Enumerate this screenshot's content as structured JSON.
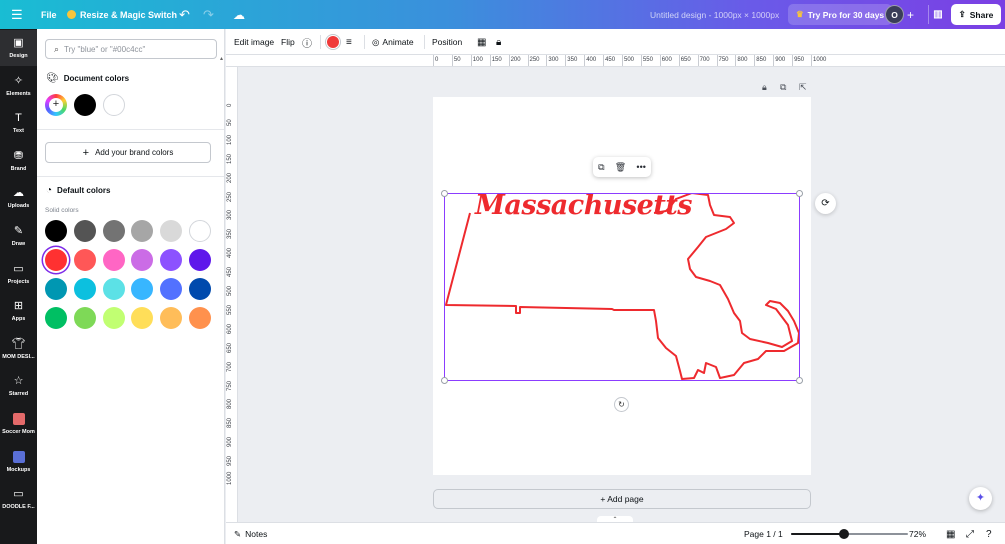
{
  "topbar": {
    "menu_icon": "hamburger-icon",
    "file_label": "File",
    "resize_label": "Resize & Magic Switch",
    "undo_icon": "undo-icon",
    "redo_icon": "redo-icon",
    "cloud_icon": "cloud-icon",
    "design_title": "Untitled design - 1000px × 1000px",
    "pro_label": "Try Pro for 30 days",
    "avatar_initial": "O",
    "share_label": "Share"
  },
  "rail": {
    "items": [
      {
        "label": "Design",
        "icon": "design-icon"
      },
      {
        "label": "Elements",
        "icon": "elements-icon"
      },
      {
        "label": "Text",
        "icon": "text-icon"
      },
      {
        "label": "Brand",
        "icon": "brand-icon"
      },
      {
        "label": "Uploads",
        "icon": "uploads-icon"
      },
      {
        "label": "Draw",
        "icon": "draw-icon"
      },
      {
        "label": "Projects",
        "icon": "folder-icon"
      },
      {
        "label": "Apps",
        "icon": "apps-icon"
      },
      {
        "label": "MOM DESI...",
        "icon": "shirt-icon"
      },
      {
        "label": "Starred",
        "icon": "star-icon"
      },
      {
        "label": "Soccer Mom",
        "icon": "app-thumb-icon"
      },
      {
        "label": "Mockups",
        "icon": "mockups-icon"
      },
      {
        "label": "DOODLE F...",
        "icon": "folder-icon"
      }
    ]
  },
  "panel": {
    "search_placeholder": "Try \"blue\" or \"#00c4cc\"",
    "document_colors_title": "Document colors",
    "document_colors": [
      "rainbow",
      "#000000",
      "#ffffff"
    ],
    "brand_button_label": "Add your brand colors",
    "default_colors_title": "Default colors",
    "solid_colors_label": "Solid colors",
    "selected_color": "#ff3131",
    "solid_colors": [
      [
        "#000000",
        "#545454",
        "#737373",
        "#a6a6a6",
        "#d9d9d9",
        "#ffffff"
      ],
      [
        "#ff3131",
        "#ff5757",
        "#ff66c4",
        "#cb6ce6",
        "#8c52ff",
        "#5e17eb"
      ],
      [
        "#0097b2",
        "#0cc0df",
        "#5ce1e6",
        "#38b6ff",
        "#5271ff",
        "#004aad"
      ],
      [
        "#00bf63",
        "#7ed957",
        "#c1ff72",
        "#ffde59",
        "#ffbd59",
        "#ff914d"
      ]
    ]
  },
  "context_toolbar": {
    "edit_image": "Edit image",
    "flip": "Flip",
    "info_icon": "info-icon",
    "stroke_icon": "stroke-weight-icon",
    "animate": "Animate",
    "position": "Position",
    "transparency_icon": "transparency-icon",
    "lock_icon": "lock-icon"
  },
  "ruler": {
    "h_ticks": [
      "0",
      "50",
      "100",
      "150",
      "200",
      "250",
      "300",
      "350",
      "400",
      "450",
      "500",
      "550",
      "600",
      "650",
      "700",
      "750",
      "800",
      "850",
      "900",
      "950",
      "1000"
    ],
    "v_ticks": [
      "0",
      "50",
      "100",
      "150",
      "200",
      "250",
      "300",
      "350",
      "400",
      "450",
      "500",
      "550",
      "600",
      "650",
      "700",
      "750",
      "800",
      "850",
      "900",
      "950",
      "1000"
    ]
  },
  "canvas": {
    "artwork_text": "Massachusetts",
    "artwork_color": "#ee2a2e",
    "selection_color": "#8b3dff",
    "add_page": "+ Add page"
  },
  "bottombar": {
    "notes": "Notes",
    "page_indicator": "Page 1 / 1",
    "zoom_percent": "72%",
    "zoom_fraction": 0.45
  }
}
